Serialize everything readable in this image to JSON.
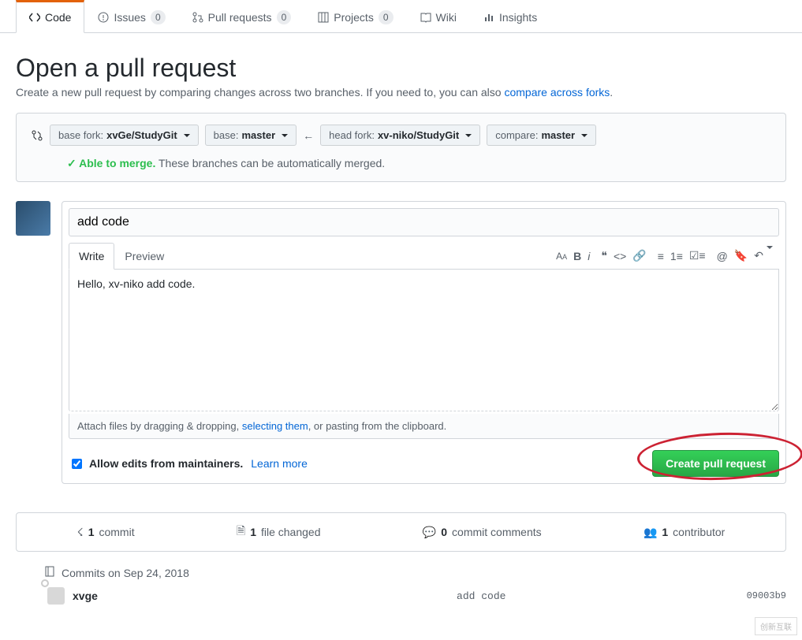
{
  "nav": {
    "code": "Code",
    "issues": "Issues",
    "issues_count": "0",
    "prs": "Pull requests",
    "prs_count": "0",
    "projects": "Projects",
    "projects_count": "0",
    "wiki": "Wiki",
    "insights": "Insights"
  },
  "page": {
    "title": "Open a pull request",
    "subtitle": "Create a new pull request by comparing changes across two branches. If you need to, you can also ",
    "subtitle_link": "compare across forks"
  },
  "compare": {
    "base_fork_label": "base fork:",
    "base_fork_value": "xvGe/StudyGit",
    "base_label": "base:",
    "base_value": "master",
    "head_fork_label": "head fork:",
    "head_fork_value": "xv-niko/StudyGit",
    "compare_label": "compare:",
    "compare_value": "master",
    "merge_ok": "Able to merge.",
    "merge_msg": "These branches can be automatically merged."
  },
  "form": {
    "title_value": "add code",
    "tab_write": "Write",
    "tab_preview": "Preview",
    "body_value": "Hello, xv-niko add code.",
    "filehint_pre": "Attach files by dragging & dropping, ",
    "filehint_link": "selecting them",
    "filehint_post": ", or pasting from the clipboard.",
    "allow_edits": "Allow edits from maintainers.",
    "learn_more": "Learn more",
    "submit": "Create pull request"
  },
  "summary": {
    "commits_n": "1",
    "commits_t": "commit",
    "files_n": "1",
    "files_t": "file changed",
    "comments_n": "0",
    "comments_t": "commit comments",
    "contrib_n": "1",
    "contrib_t": "contributor"
  },
  "commits": {
    "date_label": "Commits on Sep 24, 2018",
    "author": "xvge",
    "message": "add code",
    "sha": "09003b9"
  },
  "watermark": "创新互联"
}
